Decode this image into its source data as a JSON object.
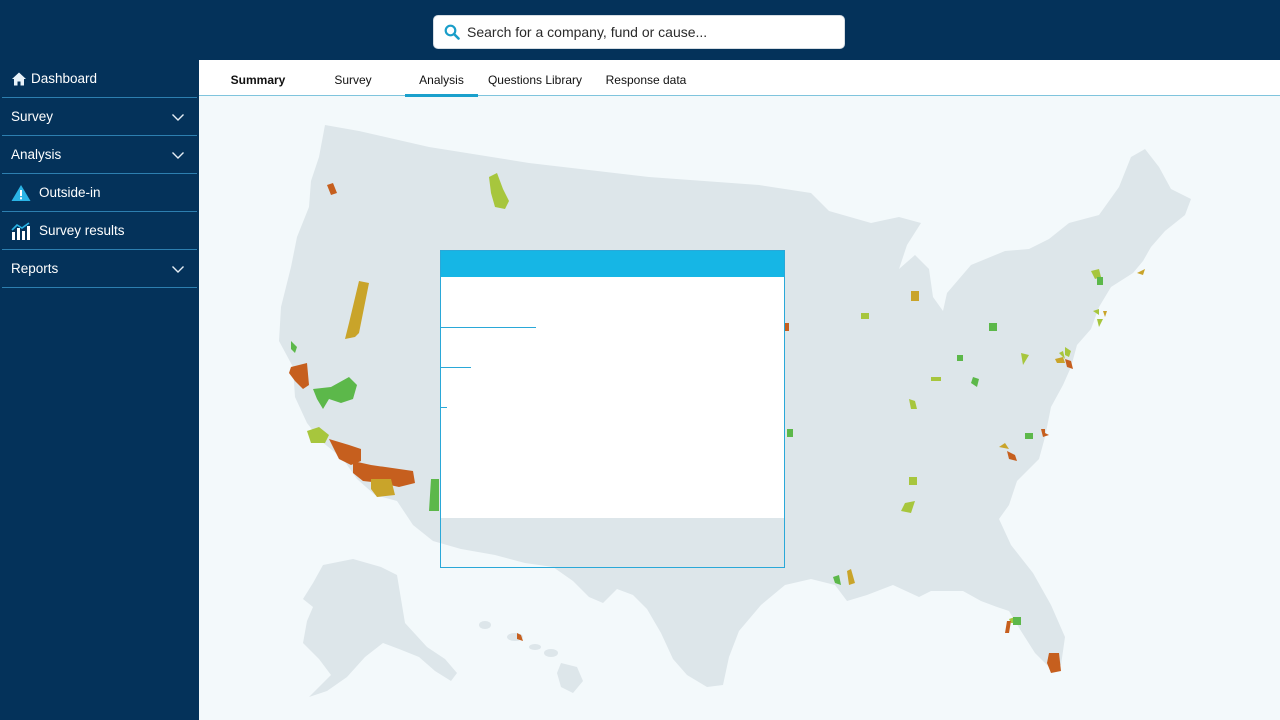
{
  "search": {
    "placeholder": "Search for a company, fund or cause..."
  },
  "sidebar": {
    "items": [
      {
        "label": "Dashboard",
        "icon": "home-icon"
      },
      {
        "label": "Survey",
        "icon": "chevron-down-icon"
      },
      {
        "label": "Analysis",
        "icon": "chevron-down-icon"
      },
      {
        "label": "Outside-in",
        "icon": "warning-icon"
      },
      {
        "label": "Survey results",
        "icon": "bar-chart-icon"
      },
      {
        "label": "Reports",
        "icon": "chevron-down-icon"
      }
    ]
  },
  "tabs": [
    {
      "label": "Summary"
    },
    {
      "label": "Survey"
    },
    {
      "label": "Analysis",
      "active": true
    },
    {
      "label": "Questions Library"
    },
    {
      "label": "Response data"
    }
  ],
  "colors": {
    "navy": "#04325a",
    "accent": "#16b6e5",
    "map_land": "#dde6ea",
    "region_dark_orange": "#c65f1e",
    "region_olive": "#c9a42a",
    "region_lime": "#a7c63d",
    "region_green": "#5cb84a"
  }
}
